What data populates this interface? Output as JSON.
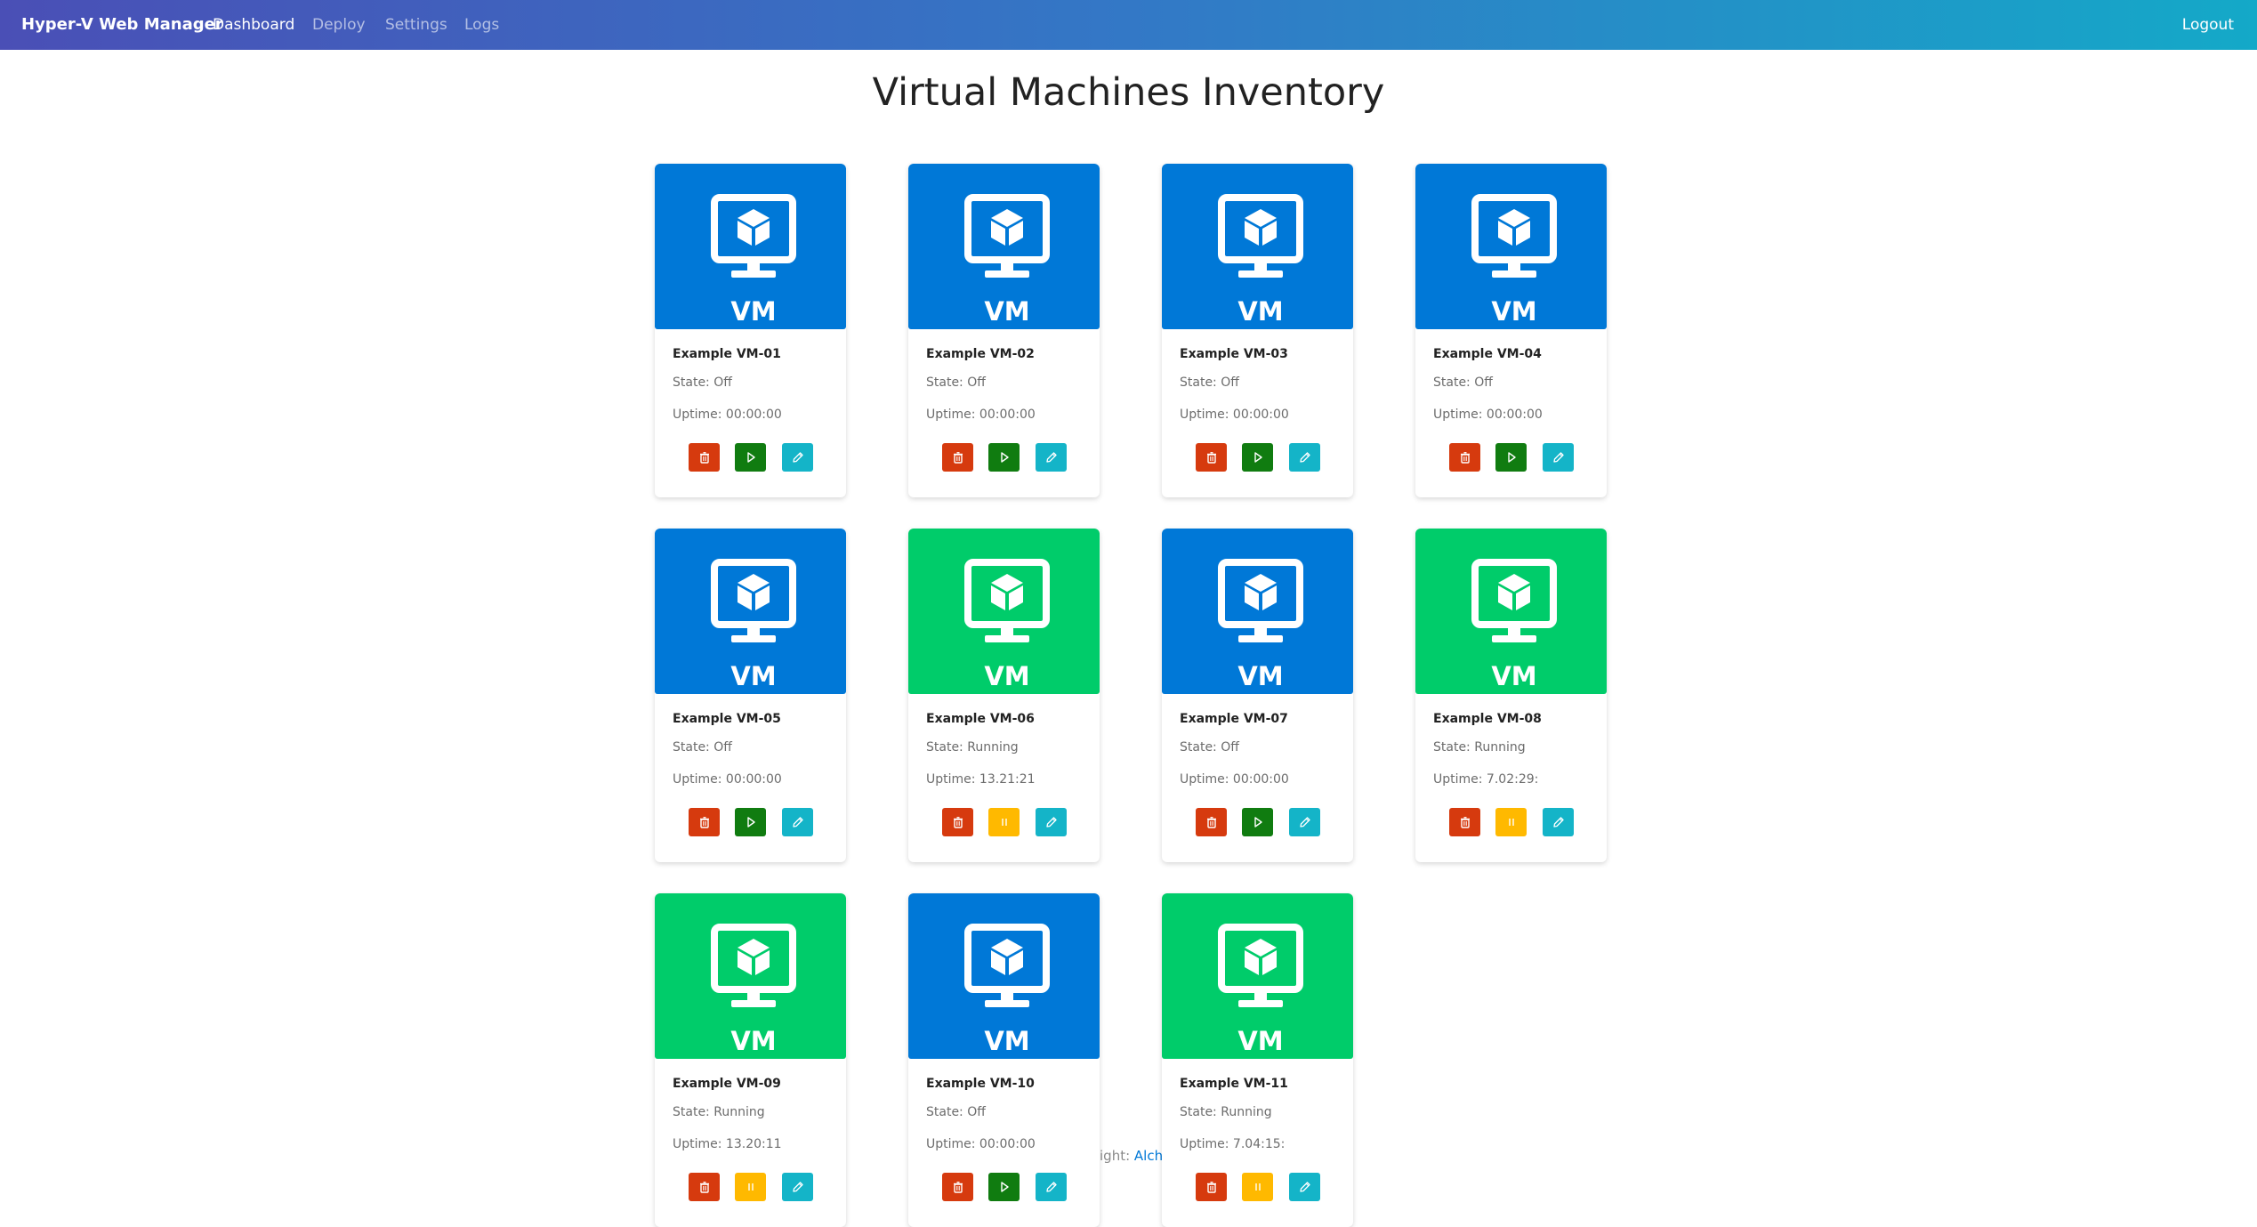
{
  "nav": {
    "brand": "Hyper-V Web Manager",
    "links": [
      {
        "label": "Dashboard",
        "active": true
      },
      {
        "label": "Deploy",
        "active": false
      },
      {
        "label": "Settings",
        "active": false
      },
      {
        "label": "Logs",
        "active": false
      }
    ],
    "logout": "Logout",
    "gradient": [
      "#4a4fb6",
      "#14a9c8"
    ]
  },
  "page": {
    "title": "Virtual Machines Inventory"
  },
  "colors": {
    "off_tile": "#0078d7",
    "running_tile": "#00cc6a",
    "delete_button": "#d63a0e",
    "start_button": "#107c10",
    "pause_button": "#ffb900",
    "edit_button": "#14b4c8"
  },
  "vms": [
    {
      "name": "Example VM-01",
      "state": "State: Off",
      "uptime": "Uptime: 00:00:00",
      "running": false,
      "tile_label": "VM",
      "icons": [
        "trash-icon",
        "play-icon",
        "pencil-icon"
      ]
    },
    {
      "name": "Example VM-02",
      "state": "State: Off",
      "uptime": "Uptime: 00:00:00",
      "running": false,
      "tile_label": "VM",
      "icons": [
        "trash-icon",
        "play-icon",
        "pencil-icon"
      ]
    },
    {
      "name": "Example VM-03",
      "state": "State: Off",
      "uptime": "Uptime: 00:00:00",
      "running": false,
      "tile_label": "VM",
      "icons": [
        "trash-icon",
        "play-icon",
        "pencil-icon"
      ]
    },
    {
      "name": "Example VM-04",
      "state": "State: Off",
      "uptime": "Uptime: 00:00:00",
      "running": false,
      "tile_label": "VM",
      "icons": [
        "trash-icon",
        "play-icon",
        "pencil-icon"
      ]
    },
    {
      "name": "Example VM-05",
      "state": "State: Off",
      "uptime": "Uptime: 00:00:00",
      "running": false,
      "tile_label": "VM",
      "icons": [
        "trash-icon",
        "play-icon",
        "pencil-icon"
      ]
    },
    {
      "name": "Example VM-06",
      "state": "State: Running",
      "uptime": "Uptime: 13.21:21",
      "running": true,
      "tile_label": "VM",
      "icons": [
        "trash-icon",
        "pause-icon",
        "pencil-icon"
      ]
    },
    {
      "name": "Example VM-07",
      "state": "State: Off",
      "uptime": "Uptime: 00:00:00",
      "running": false,
      "tile_label": "VM",
      "icons": [
        "trash-icon",
        "play-icon",
        "pencil-icon"
      ]
    },
    {
      "name": "Example VM-08",
      "state": "State: Running",
      "uptime": "Uptime: 7.02:29:",
      "running": true,
      "tile_label": "VM",
      "icons": [
        "trash-icon",
        "pause-icon",
        "pencil-icon"
      ]
    },
    {
      "name": "Example VM-09",
      "state": "State: Running",
      "uptime": "Uptime: 13.20:11",
      "running": true,
      "tile_label": "VM",
      "icons": [
        "trash-icon",
        "pause-icon",
        "pencil-icon"
      ]
    },
    {
      "name": "Example VM-10",
      "state": "State: Off",
      "uptime": "Uptime: 00:00:00",
      "running": false,
      "tile_label": "VM",
      "icons": [
        "trash-icon",
        "play-icon",
        "pencil-icon"
      ]
    },
    {
      "name": "Example VM-11",
      "state": "State: Running",
      "uptime": "Uptime: 7.04:15:",
      "running": true,
      "tile_label": "VM",
      "icons": [
        "trash-icon",
        "pause-icon",
        "pencil-icon"
      ]
    }
  ],
  "footer": {
    "prefix": "ight: ",
    "link": "Alche"
  }
}
